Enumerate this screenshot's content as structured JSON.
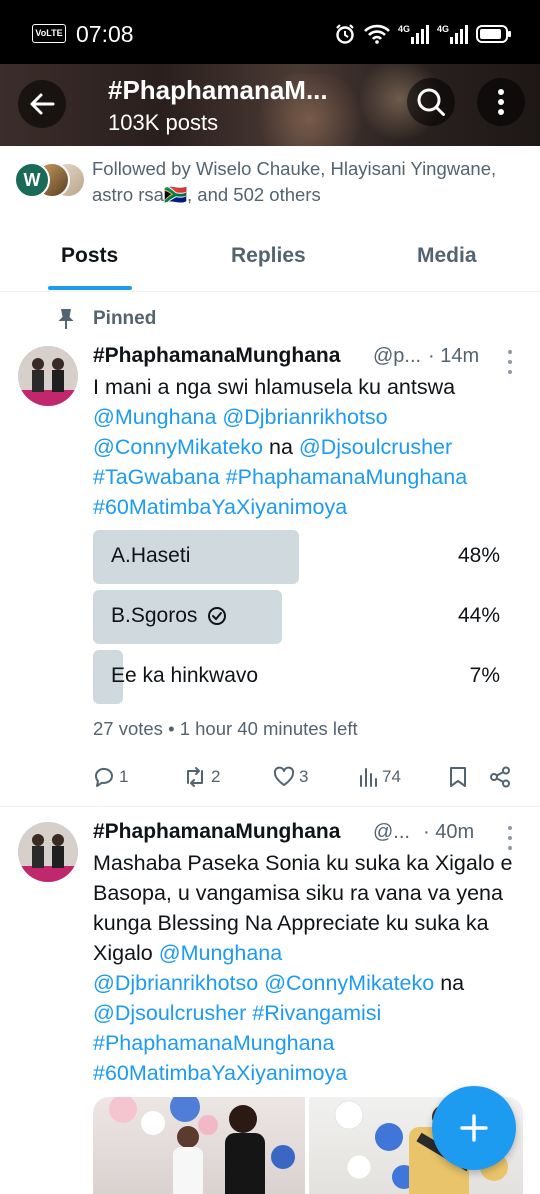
{
  "status_bar": {
    "volte": "VoLTE",
    "time": "07:08",
    "network1": "4G",
    "network2": "4G"
  },
  "header": {
    "title": "#PhaphamanaM...",
    "post_count": "103K posts"
  },
  "followers": {
    "avatar_initial": "W",
    "text": "Followed by Wiselo Chauke, Hlayisani Yingwane, astro rsa🇿🇦, and 502 others"
  },
  "tabs": [
    {
      "label": "Posts",
      "active": true
    },
    {
      "label": "Replies",
      "active": false
    },
    {
      "label": "Media",
      "active": false
    }
  ],
  "pinned_label": "Pinned",
  "tweet1": {
    "name": "#PhaphamanaMunghana",
    "handle": "@p...",
    "time": "· 14m",
    "text_plain": "I mani a nga swi hlamusela ku antswa",
    "mentions": [
      "@Munghana",
      "@Djbrianrikhotso",
      "@ConnyMikateko"
    ],
    "connector": "na",
    "mention_last": "@Djsoulcrusher",
    "hashtags": [
      "#TaGwabana",
      "#PhaphamanaMunghana",
      "#60MatimbaYaXiyanimoya"
    ],
    "poll": [
      {
        "label": "A.Haseti",
        "percent": "48%",
        "fraction": 0.48,
        "selected": false
      },
      {
        "label": "B.Sgoros",
        "percent": "44%",
        "fraction": 0.44,
        "selected": true
      },
      {
        "label": "Ee ka hinkwavo",
        "percent": "7%",
        "fraction": 0.07,
        "selected": false
      }
    ],
    "poll_meta": "27 votes • 1 hour 40 minutes left",
    "actions": {
      "replies": "1",
      "reposts": "2",
      "likes": "3",
      "views": "74"
    }
  },
  "tweet2": {
    "name": "#PhaphamanaMunghana",
    "handle": "@...",
    "time": "· 40m",
    "text_plain": "Mashaba Paseka Sonia ku suka ka Xigalo e Basopa, u vangamisa siku ra vana va yena kunga Blessing Na Appreciate ku suka ka Xigalo",
    "mentions": [
      "@Munghana",
      "@Djbrianrikhotso",
      "@ConnyMikateko"
    ],
    "connector": "na",
    "mention_last": "@Djsoulcrusher",
    "hashtags": [
      "#Rivangamisi",
      "#PhaphamanaMunghana",
      "#60MatimbaYaXiyanimoya"
    ]
  },
  "colors": {
    "accent": "#1d9bf0",
    "poll_fill": "#cfd9de",
    "secondary_text": "#536471"
  },
  "icons": {
    "back": "arrow-left-icon",
    "search": "search-icon",
    "more": "more-vertical-icon",
    "pin": "pin-icon",
    "reply": "reply-icon",
    "repost": "repost-icon",
    "like": "heart-icon",
    "views": "views-icon",
    "bookmark": "bookmark-icon",
    "share": "share-icon",
    "compose": "plus-icon"
  }
}
